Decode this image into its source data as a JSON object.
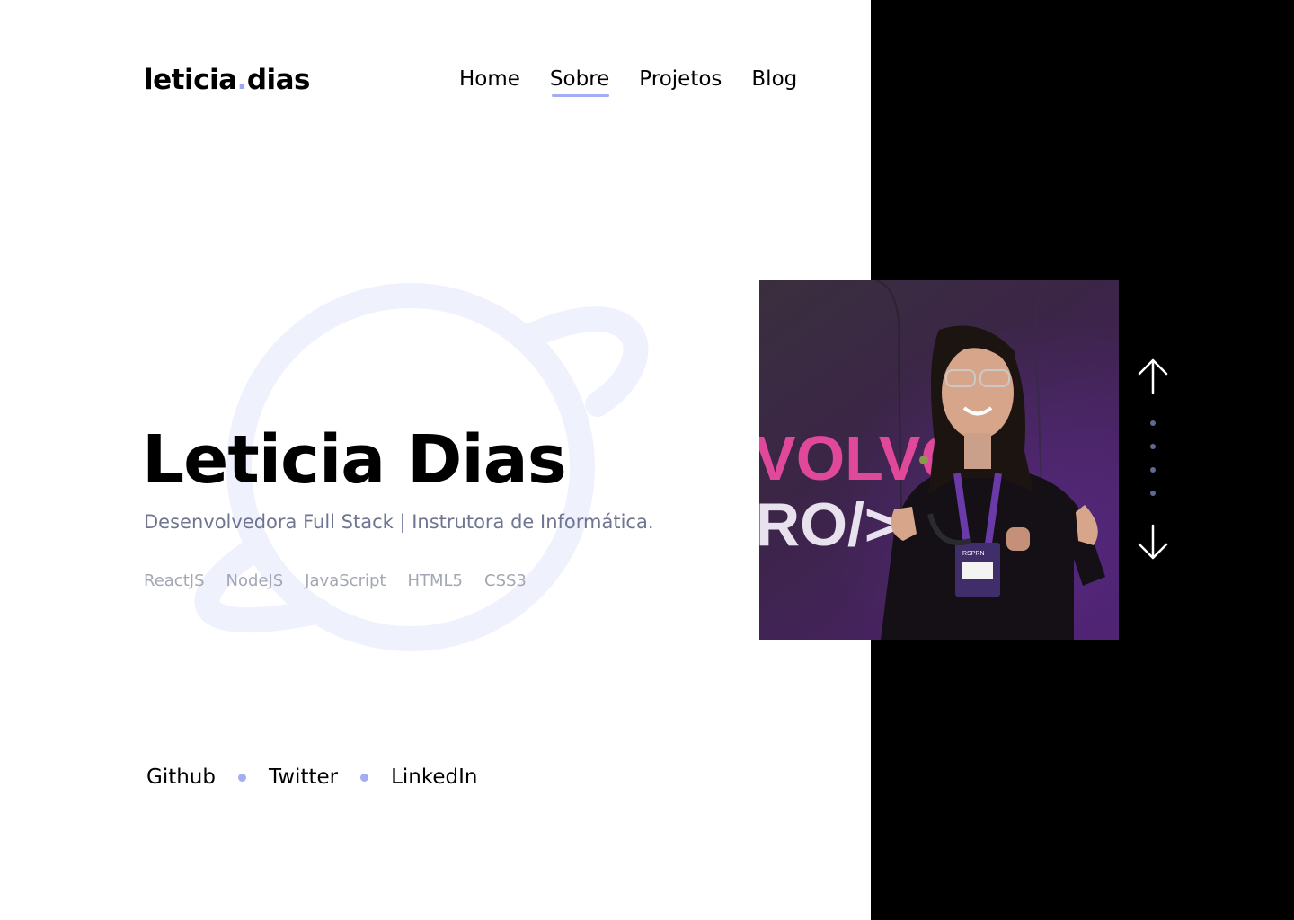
{
  "header": {
    "logo_first": "leticia",
    "logo_dot": ".",
    "logo_second": "dias",
    "nav": [
      {
        "label": "Home",
        "active": false
      },
      {
        "label": "Sobre",
        "active": true
      },
      {
        "label": "Projetos",
        "active": false
      },
      {
        "label": "Blog",
        "active": false
      }
    ]
  },
  "hero": {
    "name": "Leticia Dias",
    "role": "Desenvolvedora Full Stack | Instrutora de Informática.",
    "tags": [
      "ReactJS",
      "NodeJS",
      "JavaScript",
      "HTML5",
      "CSS3"
    ],
    "background_icon": "planet-icon"
  },
  "social": {
    "links": [
      "Github",
      "Twitter",
      "LinkedIn"
    ]
  },
  "photo": {
    "sign_line1": "VOLVO",
    "sign_line2": "RO/>",
    "badge_text": "RSPRN"
  },
  "slider": {
    "up_icon": "arrow-up-icon",
    "down_icon": "arrow-down-icon",
    "dot_count": 4
  },
  "colors": {
    "accent": "#a4adf2",
    "planet": "#eff1fd",
    "panel": "#000000",
    "subtitle": "#6f7590",
    "tags": "#a3a7b4"
  }
}
